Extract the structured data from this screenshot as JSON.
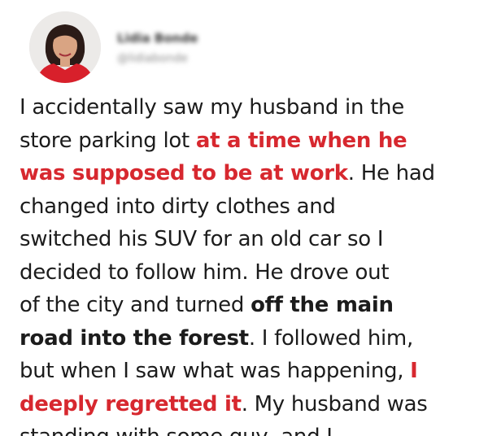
{
  "author": {
    "name": "Lidia Bonde",
    "handle": "@lidiabonde"
  },
  "post": {
    "lines": [
      [
        {
          "t": "I accidentally saw my husband in the",
          "s": "plain"
        }
      ],
      [
        {
          "t": "store parking lot ",
          "s": "plain"
        },
        {
          "t": "at a time when he",
          "s": "red"
        }
      ],
      [
        {
          "t": "was supposed to be at work",
          "s": "red"
        },
        {
          "t": ". He had",
          "s": "plain"
        }
      ],
      [
        {
          "t": "changed into dirty clothes and",
          "s": "plain"
        }
      ],
      [
        {
          "t": "switched his SUV for an old car so I",
          "s": "plain"
        }
      ],
      [
        {
          "t": "decided to follow him. He drove out",
          "s": "plain"
        }
      ],
      [
        {
          "t": "of the city and turned ",
          "s": "plain"
        },
        {
          "t": "off the main",
          "s": "bold"
        }
      ],
      [
        {
          "t": "road into the forest",
          "s": "bold"
        },
        {
          "t": ". I followed him,",
          "s": "plain"
        }
      ],
      [
        {
          "t": "but when I saw what was happening, ",
          "s": "plain"
        },
        {
          "t": "I",
          "s": "red"
        }
      ],
      [
        {
          "t": "deeply regretted it",
          "s": "red"
        },
        {
          "t": ". My husband was",
          "s": "plain"
        }
      ],
      [
        {
          "t": "standing with some guy, and I",
          "s": "plain"
        }
      ]
    ]
  },
  "colors": {
    "highlight": "#d7282f",
    "text": "#1c1c1c",
    "background": "#ffffff"
  }
}
